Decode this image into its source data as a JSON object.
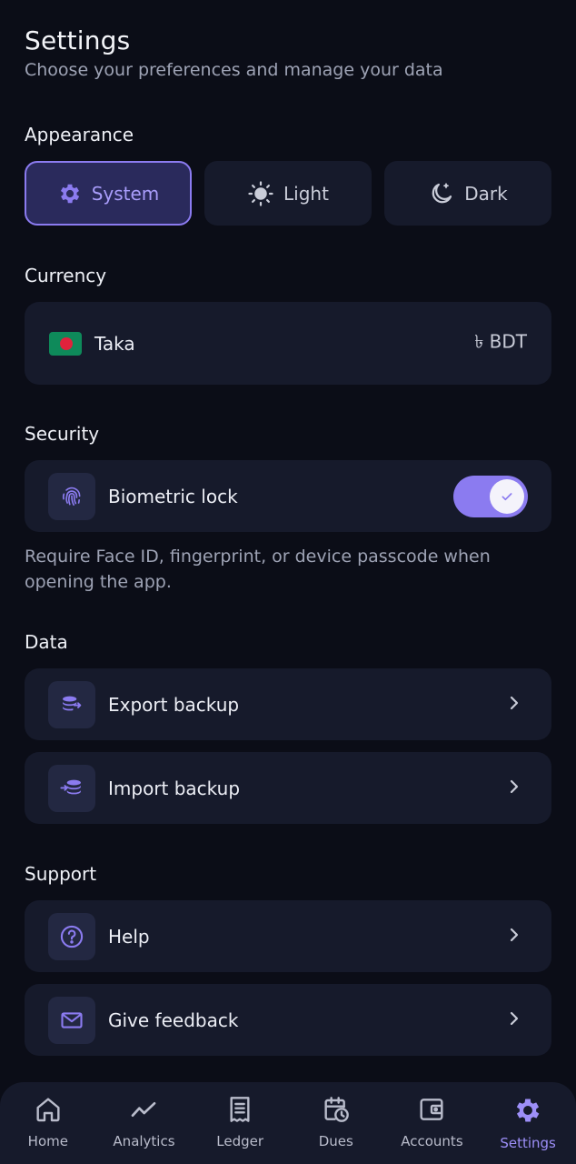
{
  "header": {
    "title": "Settings",
    "subtitle": "Choose your preferences and manage your data"
  },
  "appearance": {
    "label": "Appearance",
    "options": [
      {
        "label": "System",
        "icon": "gear-icon",
        "active": true
      },
      {
        "label": "Light",
        "icon": "sun-icon",
        "active": false
      },
      {
        "label": "Dark",
        "icon": "moon-icon",
        "active": false
      }
    ]
  },
  "currency": {
    "label": "Currency",
    "name": "Taka",
    "code": "৳ BDT",
    "flag": "bangladesh-flag"
  },
  "security": {
    "label": "Security",
    "biometric_label": "Biometric lock",
    "biometric_enabled": true,
    "note": "Require Face ID, fingerprint, or device passcode when opening the app."
  },
  "data_section": {
    "label": "Data",
    "export_label": "Export backup",
    "import_label": "Import backup"
  },
  "support": {
    "label": "Support",
    "help_label": "Help",
    "feedback_label": "Give feedback"
  },
  "nav": {
    "items": [
      {
        "label": "Home",
        "icon": "home-icon"
      },
      {
        "label": "Analytics",
        "icon": "analytics-icon"
      },
      {
        "label": "Ledger",
        "icon": "ledger-icon"
      },
      {
        "label": "Dues",
        "icon": "dues-icon"
      },
      {
        "label": "Accounts",
        "icon": "wallet-icon"
      },
      {
        "label": "Settings",
        "icon": "gear-icon",
        "active": true
      }
    ]
  },
  "colors": {
    "background": "#0b0d17",
    "card": "#161a2b",
    "accent": "#8b7bf0",
    "accent_text": "#a99dfb"
  }
}
